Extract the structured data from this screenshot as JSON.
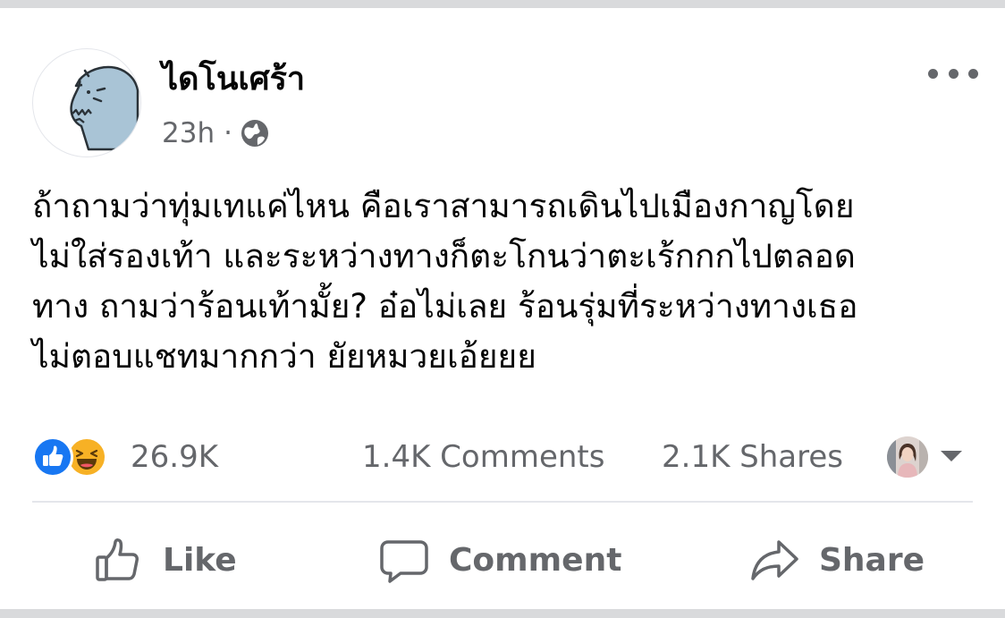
{
  "post": {
    "author": "ไดโนเศร้า",
    "time": "23h",
    "separator": "·",
    "privacy_icon": "globe-icon",
    "text": "ถ้าถามว่าทุ่มเทแค่ไหน คือเราสามารถเดินไปเมืองกาญโดย\nไม่ใส่รองเท้า และระหว่างทางก็ตะโกนว่าตะเร้กกกไปตลอด\nทาง ถามว่าร้อนเท้ามั้ย? อ๋อไม่เลย ร้อนรุ่มที่ระหว่างทางเธอ\nไม่ตอบแชทมากกว่า ยัยหมวยเอ้ยยย"
  },
  "stats": {
    "reactions_count": "26.9K",
    "comments": "1.4K Comments",
    "shares": "2.1K Shares",
    "reaction_icons": [
      "like-icon",
      "haha-icon"
    ]
  },
  "actions": {
    "like_label": "Like",
    "comment_label": "Comment",
    "share_label": "Share"
  },
  "colors": {
    "text_primary": "#050505",
    "text_secondary": "#65676b",
    "like_blue": "#1877f2",
    "haha_yellow": "#f7b125",
    "avatar_dino": "#a9c4d6",
    "divider": "#e4e6eb"
  }
}
